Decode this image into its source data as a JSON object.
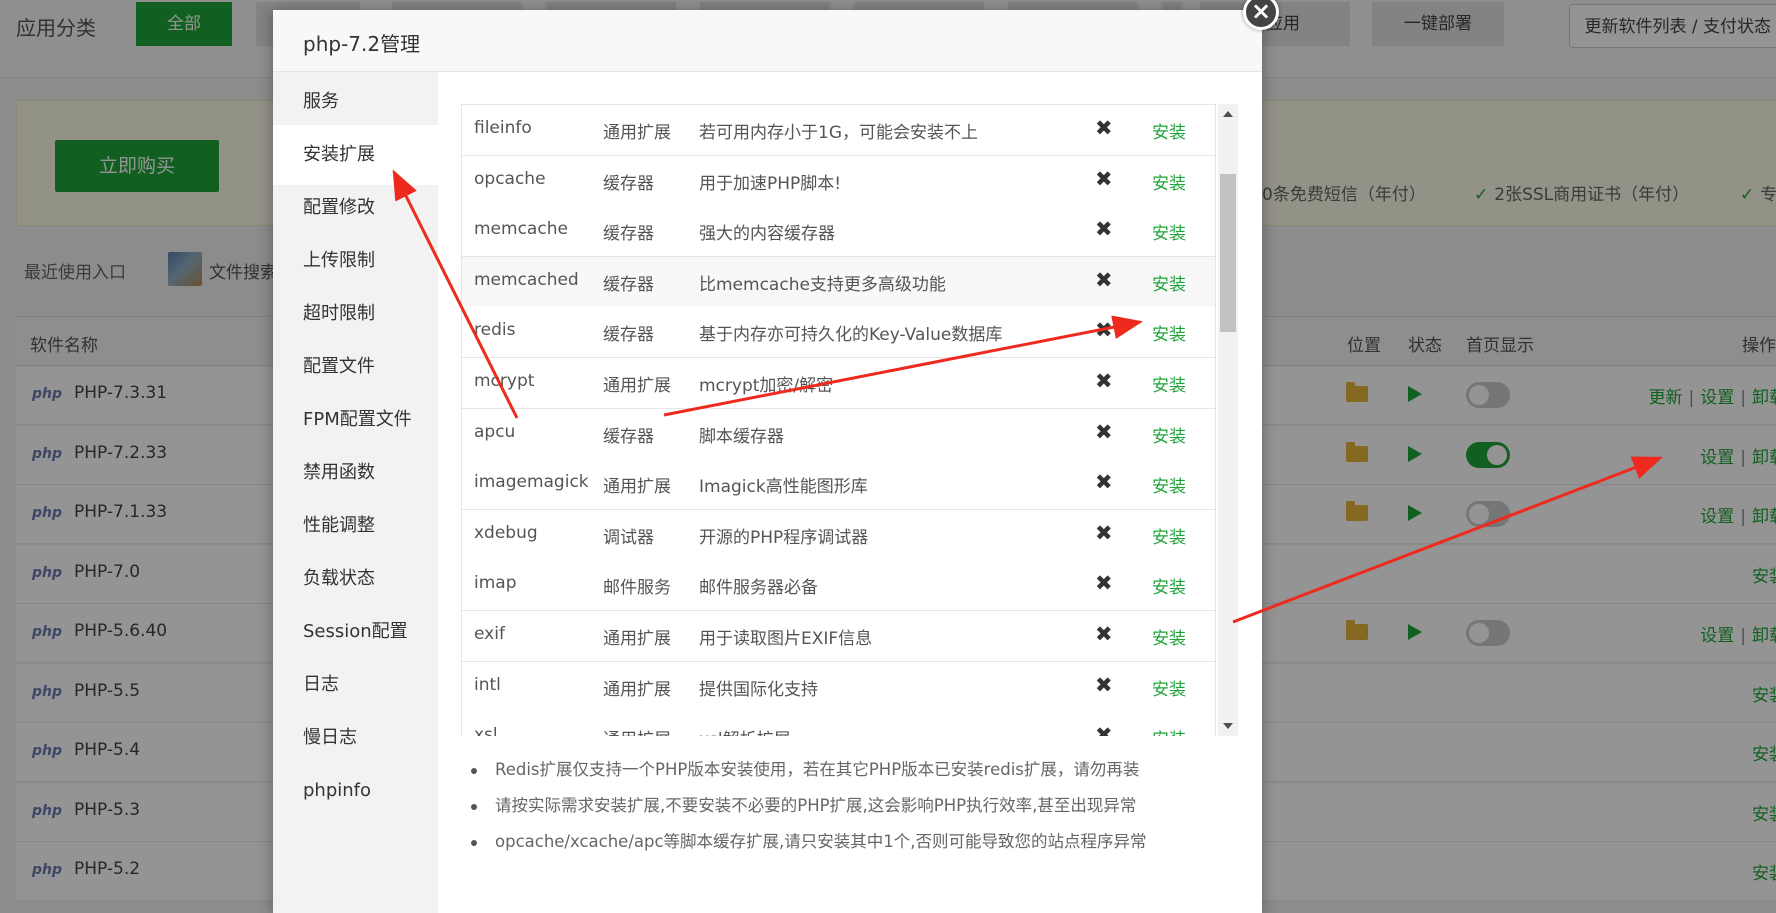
{
  "topbar": {
    "category_label": "应用分类",
    "tabs": [
      {
        "label": "全部",
        "active": true
      },
      {
        "label": "",
        "active": false
      },
      {
        "label": "",
        "active": false
      },
      {
        "label": "",
        "active": false
      },
      {
        "label": "",
        "active": false
      },
      {
        "label": "",
        "active": false
      },
      {
        "label": "",
        "active": false
      },
      {
        "label": "",
        "active": false
      },
      {
        "label": "应用",
        "active": false
      },
      {
        "label": "一键部署",
        "active": false
      }
    ],
    "update_button": "更新软件列表 / 支付状态"
  },
  "promo": {
    "buy_button": "立即购买",
    "items": [
      "0条免费短信（年付）",
      "2张SSL商用证书（年付）",
      "专"
    ]
  },
  "recent": {
    "label": "最近使用入口",
    "file_search": "文件搜索"
  },
  "software_table": {
    "headers": {
      "name": "软件名称",
      "position": "位置",
      "status": "状态",
      "homepage": "首页显示",
      "ops": "操作"
    },
    "rows": [
      {
        "logo": "php",
        "name": "PHP-7.3.31",
        "installed": true,
        "toggle_on": false,
        "ops": [
          "更新",
          "设置",
          "卸载"
        ]
      },
      {
        "logo": "php",
        "name": "PHP-7.2.33",
        "installed": true,
        "toggle_on": true,
        "ops": [
          "设置",
          "卸载"
        ]
      },
      {
        "logo": "php",
        "name": "PHP-7.1.33",
        "installed": true,
        "toggle_on": false,
        "ops": [
          "设置",
          "卸载"
        ]
      },
      {
        "logo": "php",
        "name": "PHP-7.0",
        "installed": false,
        "ops": [
          "安装"
        ]
      },
      {
        "logo": "php",
        "name": "PHP-5.6.40",
        "installed": true,
        "toggle_on": false,
        "ops": [
          "设置",
          "卸载"
        ]
      },
      {
        "logo": "php",
        "name": "PHP-5.5",
        "installed": false,
        "ops": [
          "安装"
        ]
      },
      {
        "logo": "php",
        "name": "PHP-5.4",
        "installed": false,
        "ops": [
          "安装"
        ]
      },
      {
        "logo": "php",
        "name": "PHP-5.3",
        "installed": false,
        "ops": [
          "安装"
        ]
      },
      {
        "logo": "php",
        "name": "PHP-5.2",
        "installed": false,
        "ops": [
          "安装"
        ]
      }
    ]
  },
  "modal": {
    "title": "php-7.2管理",
    "close_icon": "×",
    "menu": [
      {
        "label": "服务",
        "active": false
      },
      {
        "label": "安装扩展",
        "active": true
      },
      {
        "label": "配置修改",
        "active": false
      },
      {
        "label": "上传限制",
        "active": false
      },
      {
        "label": "超时限制",
        "active": false
      },
      {
        "label": "配置文件",
        "active": false
      },
      {
        "label": "FPM配置文件",
        "active": false
      },
      {
        "label": "禁用函数",
        "active": false
      },
      {
        "label": "性能调整",
        "active": false
      },
      {
        "label": "负载状态",
        "active": false
      },
      {
        "label": "Session配置",
        "active": false
      },
      {
        "label": "日志",
        "active": false
      },
      {
        "label": "慢日志",
        "active": false
      },
      {
        "label": "phpinfo",
        "active": false
      }
    ],
    "extensions": [
      {
        "name": "fileinfo",
        "type": "通用扩展",
        "desc": "若可用内存小于1G，可能会安装不上",
        "status_icon": "✖",
        "action": "安装"
      },
      {
        "name": "opcache",
        "type": "缓存器",
        "desc": "用于加速PHP脚本!",
        "status_icon": "✖",
        "action": "安装"
      },
      {
        "name": "memcache",
        "type": "缓存器",
        "desc": "强大的内容缓存器",
        "status_icon": "✖",
        "action": "安装"
      },
      {
        "name": "memcached",
        "type": "缓存器",
        "desc": "比memcache支持更多高级功能",
        "status_icon": "✖",
        "action": "安装"
      },
      {
        "name": "redis",
        "type": "缓存器",
        "desc": "基于内存亦可持久化的Key-Value数据库",
        "status_icon": "✖",
        "action": "安装"
      },
      {
        "name": "mcrypt",
        "type": "通用扩展",
        "desc": "mcrypt加密/解密",
        "status_icon": "✖",
        "action": "安装"
      },
      {
        "name": "apcu",
        "type": "缓存器",
        "desc": "脚本缓存器",
        "status_icon": "✖",
        "action": "安装"
      },
      {
        "name": "imagemagick",
        "type": "通用扩展",
        "desc": "Imagick高性能图形库",
        "status_icon": "✖",
        "action": "安装"
      },
      {
        "name": "xdebug",
        "type": "调试器",
        "desc": "开源的PHP程序调试器",
        "status_icon": "✖",
        "action": "安装"
      },
      {
        "name": "imap",
        "type": "邮件服务",
        "desc": "邮件服务器必备",
        "status_icon": "✖",
        "action": "安装"
      },
      {
        "name": "exif",
        "type": "通用扩展",
        "desc": "用于读取图片EXIF信息",
        "status_icon": "✖",
        "action": "安装"
      },
      {
        "name": "intl",
        "type": "通用扩展",
        "desc": "提供国际化支持",
        "status_icon": "✖",
        "action": "安装"
      },
      {
        "name": "xsl",
        "type": "通用扩展",
        "desc": "xsl解析扩展",
        "status_icon": "✖",
        "action": "安装"
      }
    ],
    "notes": [
      "Redis扩展仅支持一个PHP版本安装使用，若在其它PHP版本已安装redis扩展，请勿再装",
      "请按实际需求安装扩展,不要安装不必要的PHP扩展,这会影响PHP执行效率,甚至出现异常",
      "opcache/xcache/apc等脚本缓存扩展,请只安装其中1个,否则可能导致您的站点程序异常"
    ]
  },
  "colors": {
    "accent": "#20a53a",
    "annotation_arrow": "#ee2a1f"
  }
}
